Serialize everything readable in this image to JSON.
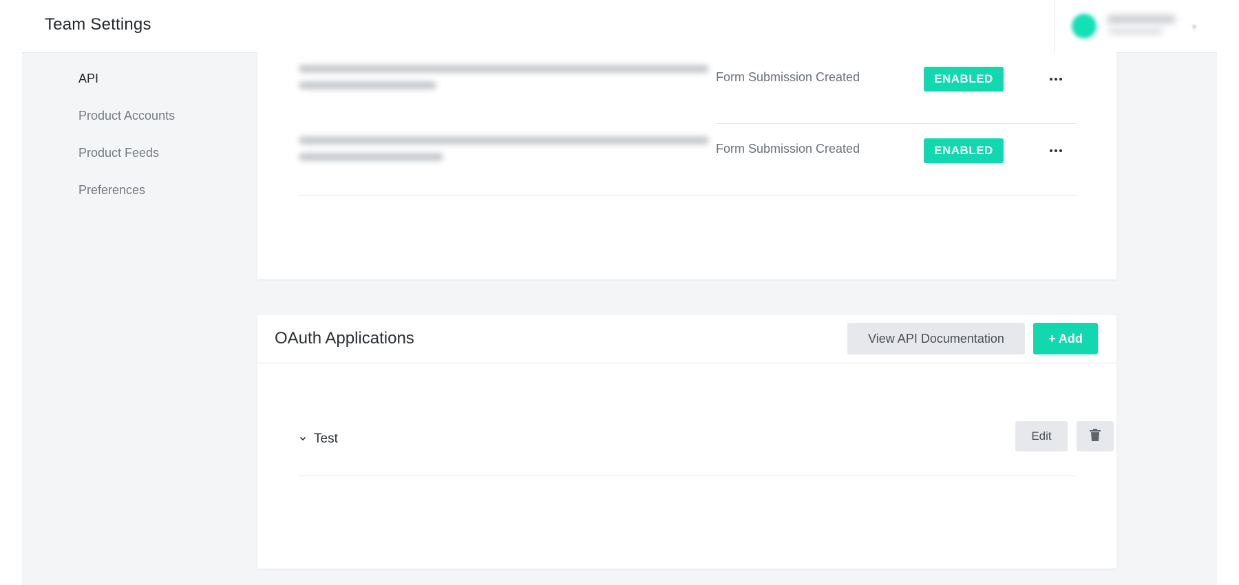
{
  "header": {
    "title": "Team Settings"
  },
  "sidebar": {
    "items": [
      {
        "label": "API",
        "active": true
      },
      {
        "label": "Product Accounts",
        "active": false
      },
      {
        "label": "Product Feeds",
        "active": false
      },
      {
        "label": "Preferences",
        "active": false
      }
    ]
  },
  "webhooks": {
    "rows": [
      {
        "event": "Form Submission Created",
        "status": "ENABLED"
      },
      {
        "event": "Form Submission Created",
        "status": "ENABLED"
      }
    ]
  },
  "oauth": {
    "title": "OAuth Applications",
    "docs_button": "View API Documentation",
    "add_button": "+ Add",
    "apps": [
      {
        "name": "Test",
        "edit_label": "Edit"
      }
    ]
  },
  "colors": {
    "accent": "#12d8b0",
    "button_secondary": "#e6e8ec",
    "page_background": "#f4f5f6"
  },
  "icons": {
    "row_menu": "more-horizontal-icon",
    "expand": "chevron-down-icon",
    "delete": "trash-icon"
  }
}
